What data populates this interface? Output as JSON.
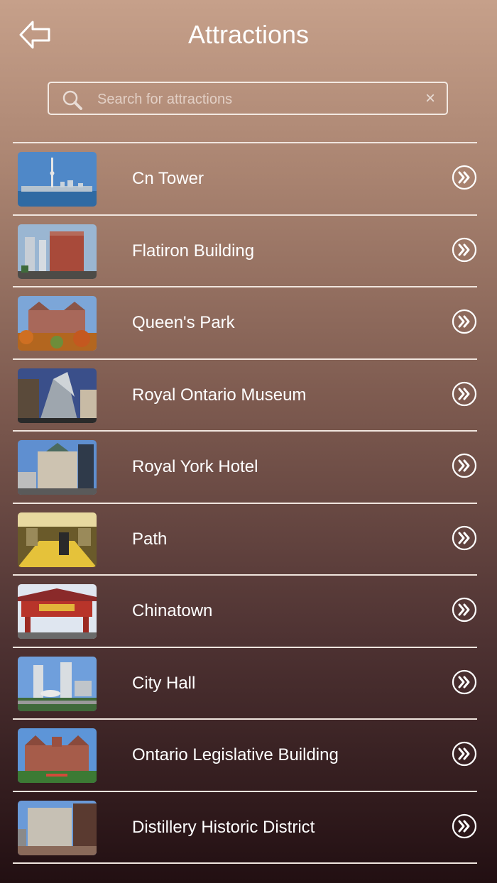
{
  "header": {
    "title": "Attractions",
    "back_icon": "back-arrow-icon"
  },
  "search": {
    "placeholder": "Search for attractions",
    "value": "",
    "clear_label": "×"
  },
  "attractions": [
    {
      "name": "Cn Tower",
      "thumb": "cn-tower"
    },
    {
      "name": "Flatiron Building",
      "thumb": "flatiron"
    },
    {
      "name": "Queen's Park",
      "thumb": "queens-park"
    },
    {
      "name": "Royal Ontario Museum",
      "thumb": "rom"
    },
    {
      "name": "Royal York Hotel",
      "thumb": "royal-york"
    },
    {
      "name": "Path",
      "thumb": "path"
    },
    {
      "name": "Chinatown",
      "thumb": "chinatown"
    },
    {
      "name": "City Hall",
      "thumb": "city-hall"
    },
    {
      "name": "Ontario Legislative Building",
      "thumb": "legislature"
    },
    {
      "name": "Distillery Historic District",
      "thumb": "distillery"
    }
  ],
  "row_icon": "double-chevron-right-icon",
  "colors": {
    "top": "#c6a08a",
    "bottom": "#220f12",
    "line": "#f1e6df"
  }
}
